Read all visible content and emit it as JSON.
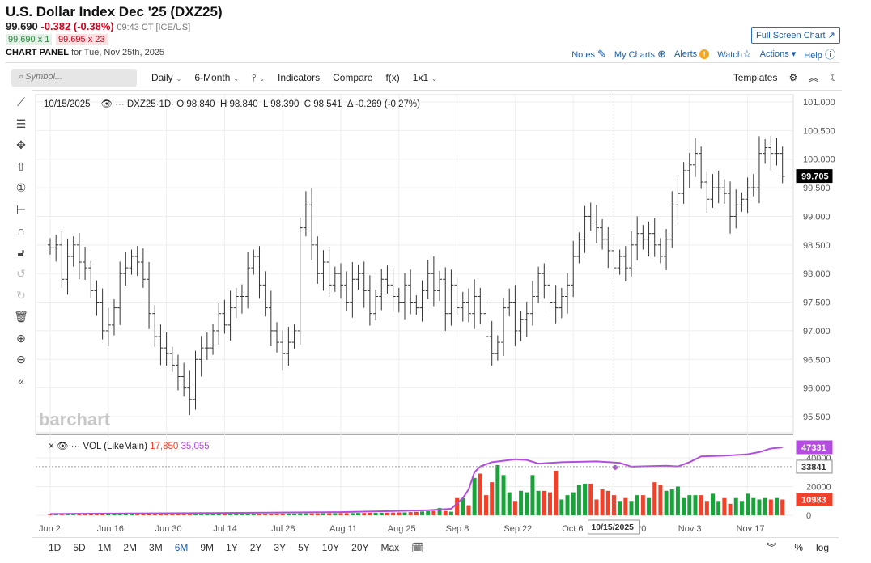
{
  "header": {
    "title": "U.S. Dollar Index Dec '25 (DXZ25)",
    "last": "99.690",
    "change": "-0.382 (-0.38%)",
    "time": "09:43 CT [ICE/US]",
    "bid": "99.690 x 1",
    "ask": "99.695 x 23",
    "panel_label": "CHART PANEL",
    "panel_date": "for Tue, Nov 25th, 2025",
    "full_screen": "Full Screen Chart"
  },
  "links": {
    "notes": "Notes",
    "my_charts": "My Charts",
    "alerts": "Alerts",
    "watch": "Watch",
    "actions": "Actions",
    "help": "Help"
  },
  "toolbar": {
    "search_placeholder": "Symbol...",
    "interval": "Daily",
    "range": "6-Month",
    "indicators": "Indicators",
    "compare": "Compare",
    "fx": "f(x)",
    "layout": "1x1",
    "templates": "Templates"
  },
  "ohlc_legend": {
    "date": "10/15/2025",
    "symbol": "DXZ25",
    "interval": "·1D·",
    "o": "O 98.840",
    "h": "H 98.840",
    "l": "L 98.390",
    "c": "C 98.541",
    "delta": "Δ -0.269 (-0.27%)"
  },
  "volume_legend": {
    "label": "VOL (LikeMain)",
    "vol": "17,850",
    "avg": "35,055"
  },
  "watermark": "barchart",
  "crosshair_date": "10/15/2025",
  "bottom": {
    "ranges": [
      "1D",
      "5D",
      "1M",
      "2M",
      "3M",
      "6M",
      "9M",
      "1Y",
      "2Y",
      "3Y",
      "5Y",
      "10Y",
      "20Y",
      "Max"
    ],
    "active": "6M",
    "pct": "%",
    "log": "log"
  },
  "colors": {
    "up": "#1aa33a",
    "down": "#f0412a",
    "avg": "#b44ce0",
    "link": "#1d5ea8"
  },
  "chart_data": {
    "type": "ohlc",
    "start": "2025-06-02",
    "price_ticks": [
      "101.000",
      "100.500",
      "100.000",
      "99.500",
      "99.000",
      "98.500",
      "98.000",
      "97.500",
      "97.000",
      "96.500",
      "96.000",
      "95.500"
    ],
    "ylim": [
      95.5,
      101.0
    ],
    "last_price_label": "99.705",
    "x_ticks": [
      {
        "i": 0,
        "label": "Jun 2"
      },
      {
        "i": 10,
        "label": "Jun 16"
      },
      {
        "i": 20,
        "label": "Jun 30"
      },
      {
        "i": 30,
        "label": "Jul 14"
      },
      {
        "i": 40,
        "label": "Jul 28"
      },
      {
        "i": 50,
        "label": "Aug 11"
      },
      {
        "i": 60,
        "label": "Aug 25"
      },
      {
        "i": 70,
        "label": "Sep 8"
      },
      {
        "i": 80,
        "label": "Sep 22"
      },
      {
        "i": 90,
        "label": "Oct 6"
      },
      {
        "i": 100,
        "label": "Oct 20"
      },
      {
        "i": 110,
        "label": "Nov 3"
      },
      {
        "i": 120,
        "label": "Nov 17"
      }
    ],
    "close": [
      98.45,
      98.5,
      97.9,
      98.3,
      98.5,
      98.2,
      98.1,
      97.7,
      97.5,
      97.0,
      97.1,
      97.4,
      98.0,
      98.1,
      98.3,
      98.2,
      97.9,
      97.3,
      96.9,
      96.7,
      96.6,
      96.4,
      96.2,
      96.0,
      95.8,
      96.5,
      96.7,
      96.7,
      97.0,
      97.3,
      97.1,
      97.4,
      97.6,
      97.6,
      98.1,
      98.3,
      97.8,
      97.4,
      97.0,
      96.8,
      96.6,
      96.8,
      97.0,
      98.8,
      99.2,
      98.5,
      98.0,
      98.2,
      97.8,
      98.0,
      97.8,
      97.5,
      97.9,
      98.0,
      97.7,
      97.3,
      97.6,
      97.9,
      97.8,
      97.6,
      97.5,
      97.8,
      97.5,
      97.4,
      97.7,
      98.0,
      97.7,
      97.9,
      97.3,
      97.8,
      97.4,
      97.5,
      97.3,
      97.6,
      97.3,
      96.9,
      96.6,
      96.8,
      97.4,
      97.5,
      97.0,
      97.2,
      97.3,
      97.6,
      98.0,
      97.8,
      97.5,
      97.4,
      97.6,
      97.8,
      98.3,
      98.6,
      99.0,
      98.9,
      98.8,
      98.6,
      98.4,
      98.1,
      98.3,
      98.1,
      98.5,
      98.7,
      98.6,
      98.7,
      98.5,
      98.3,
      98.6,
      99.2,
      99.4,
      99.8,
      99.9,
      100.1,
      99.6,
      99.3,
      99.5,
      99.5,
      99.4,
      99.0,
      99.2,
      99.3,
      99.5,
      99.5,
      100.1,
      100.2,
      100.1,
      100.1,
      99.7
    ],
    "volume_ylim": [
      0,
      47000
    ],
    "volume_ticks": [
      "40000",
      "20000",
      "0"
    ],
    "volume_labels": {
      "avg_last": "47331",
      "crosshair_avg": "33841",
      "last_vol": "10983"
    },
    "volume": [
      500,
      500,
      500,
      500,
      500,
      600,
      600,
      600,
      600,
      600,
      700,
      700,
      700,
      700,
      700,
      700,
      700,
      800,
      800,
      800,
      800,
      800,
      900,
      900,
      900,
      900,
      900,
      900,
      1000,
      1000,
      1000,
      1000,
      1000,
      1000,
      1100,
      1100,
      1100,
      1100,
      1100,
      1200,
      1200,
      1200,
      1200,
      1300,
      1300,
      1300,
      1300,
      1400,
      1400,
      1400,
      1500,
      1500,
      1500,
      1600,
      1600,
      1700,
      1700,
      1800,
      1800,
      1900,
      2000,
      2000,
      2200,
      2400,
      2600,
      2800,
      3000,
      5000,
      3000,
      2500,
      12000,
      12000,
      7000,
      26000,
      29000,
      14000,
      23000,
      35000,
      28000,
      16000,
      10000,
      17000,
      16000,
      28000,
      17000,
      17000,
      16000,
      31000,
      11000,
      14000,
      16000,
      21000,
      22000,
      22000,
      11000,
      18000,
      17000,
      14000,
      10000,
      12000,
      10000,
      14000,
      14000,
      12000,
      23000,
      21000,
      17000,
      18000,
      20000,
      12000,
      14000,
      14000,
      14000,
      10000,
      15000,
      10000,
      12000,
      8000,
      12000,
      10000,
      15000,
      12000,
      11000,
      12000,
      11000,
      12000,
      10983
    ],
    "volume_avg": [
      [
        0,
        900
      ],
      [
        10,
        1200
      ],
      [
        30,
        1600
      ],
      [
        50,
        2200
      ],
      [
        65,
        3500
      ],
      [
        69,
        4500
      ],
      [
        71,
        12000
      ],
      [
        72,
        18000
      ],
      [
        73,
        30000
      ],
      [
        74,
        34000
      ],
      [
        76,
        37000
      ],
      [
        80,
        39000
      ],
      [
        82,
        38500
      ],
      [
        84,
        36000
      ],
      [
        88,
        37000
      ],
      [
        94,
        37500
      ],
      [
        98,
        36500
      ],
      [
        100,
        33841
      ],
      [
        106,
        34500
      ],
      [
        108,
        34000
      ],
      [
        110,
        37000
      ],
      [
        112,
        41000
      ],
      [
        116,
        41500
      ],
      [
        120,
        42500
      ],
      [
        122,
        44000
      ],
      [
        124,
        46500
      ],
      [
        126,
        47331
      ]
    ]
  }
}
